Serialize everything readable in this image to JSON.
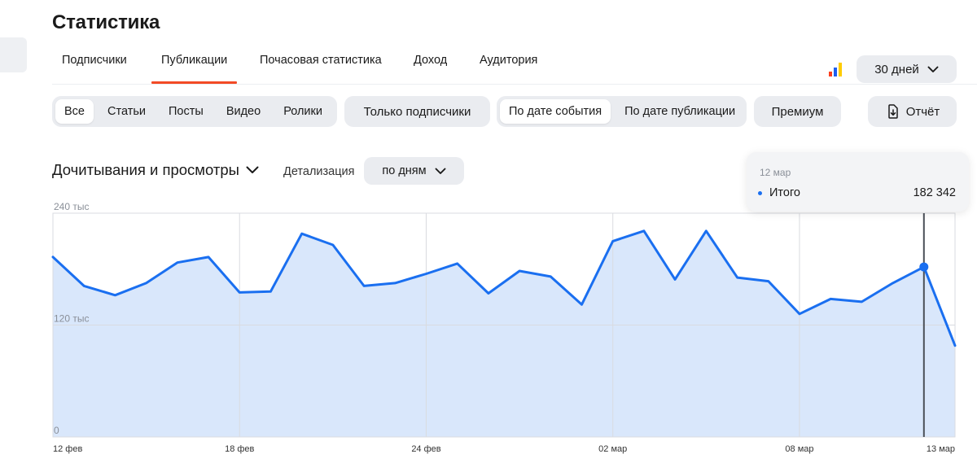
{
  "header": {
    "title": "Статистика"
  },
  "tabs": [
    {
      "label": "Подписчики",
      "active": false
    },
    {
      "label": "Публикации",
      "active": true
    },
    {
      "label": "Почасовая статистика",
      "active": false
    },
    {
      "label": "Доход",
      "active": false
    },
    {
      "label": "Аудитория",
      "active": false
    }
  ],
  "period": {
    "label": "30 дней"
  },
  "brand_colors": [
    "#fc3f1d",
    "#1f5ff0",
    "#ffcc00"
  ],
  "filters": {
    "content_types": [
      "Все",
      "Статьи",
      "Посты",
      "Видео",
      "Ролики"
    ],
    "content_active": "Все",
    "subscribers_only": "Только подписчики",
    "date_modes": [
      "По дате события",
      "По дате публикации"
    ],
    "date_active": "По дате события",
    "premium": "Премиум",
    "report": "Отчёт"
  },
  "metric": {
    "selected": "Дочитывания и просмотры",
    "detail_label": "Детализация",
    "detail_value": "по дням"
  },
  "tooltip": {
    "date": "12 мар",
    "series": "Итого",
    "value": "182 342",
    "color": "#1a6ff0"
  },
  "chart_data": {
    "type": "area",
    "color": "#1a6ff0",
    "fill": "#d9e7fb",
    "ylim": [
      0,
      240000
    ],
    "y_ticks": [
      {
        "value": 0,
        "label": "0"
      },
      {
        "value": 120000,
        "label": "120 тыс"
      },
      {
        "value": 240000,
        "label": "240 тыс"
      }
    ],
    "x_ticks": [
      {
        "index": 0,
        "label": "12 фев"
      },
      {
        "index": 6,
        "label": "18 фев"
      },
      {
        "index": 12,
        "label": "24 фев"
      },
      {
        "index": 18,
        "label": "02 мар"
      },
      {
        "index": 24,
        "label": "08 мар"
      },
      {
        "index": 29,
        "label": "13 мар"
      }
    ],
    "highlight_index": 28,
    "dates": [
      "12 фев",
      "13 фев",
      "14 фев",
      "15 фев",
      "16 фев",
      "17 фев",
      "18 фев",
      "19 фев",
      "20 фев",
      "21 фев",
      "22 фев",
      "23 фев",
      "24 фев",
      "25 фев",
      "26 фев",
      "27 фев",
      "28 фев",
      "01 мар",
      "02 мар",
      "03 мар",
      "04 мар",
      "05 мар",
      "06 мар",
      "07 мар",
      "08 мар",
      "09 мар",
      "10 мар",
      "11 мар",
      "12 мар",
      "13 мар"
    ],
    "values": [
      193000,
      162000,
      152000,
      165000,
      187000,
      193000,
      155000,
      156000,
      218000,
      206000,
      162000,
      165000,
      175000,
      186000,
      154000,
      178000,
      172000,
      142000,
      210000,
      221000,
      169000,
      221000,
      171000,
      167000,
      132000,
      148000,
      145000,
      165000,
      182342,
      98000
    ]
  }
}
